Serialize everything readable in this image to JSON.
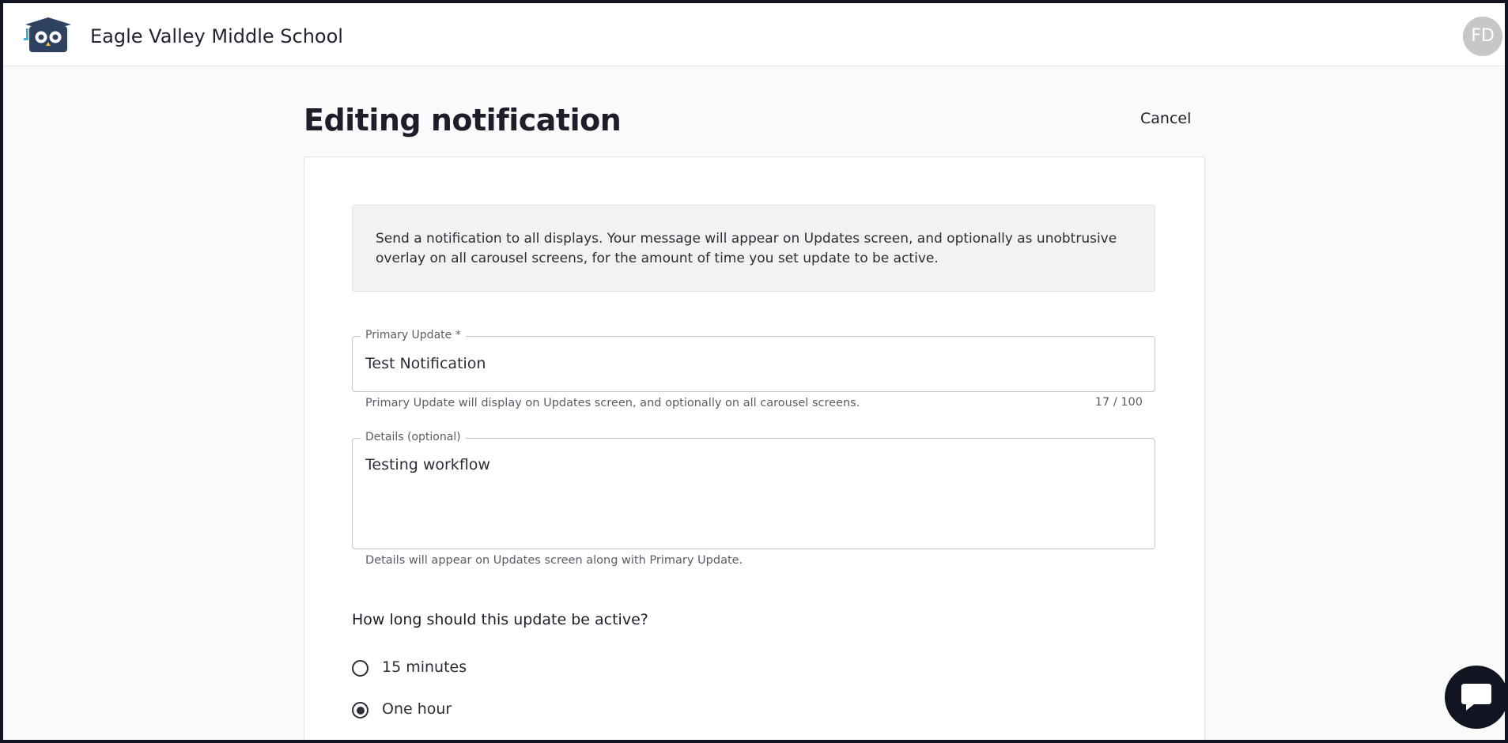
{
  "header": {
    "school_name": "Eagle Valley Middle School",
    "avatar_initials": "FD",
    "logo_icon": "owl-graduation-cap-icon"
  },
  "page": {
    "title": "Editing notification",
    "cancel_label": "Cancel"
  },
  "form": {
    "info_text": "Send a notification to all displays. Your message will appear on Updates screen, and optionally as unobtrusive overlay on all carousel screens, for the amount of time you set update to be active.",
    "primary_update": {
      "label": "Primary Update *",
      "value": "Test Notification",
      "helper": "Primary Update will display on Updates screen, and optionally on all carousel screens.",
      "counter": "17 / 100"
    },
    "details": {
      "label": "Details (optional)",
      "value": "Testing workflow",
      "helper": "Details will appear on Updates screen along with Primary Update."
    },
    "duration": {
      "question": "How long should this update be active?",
      "options": [
        {
          "label": "15 minutes",
          "selected": false
        },
        {
          "label": "One hour",
          "selected": true
        }
      ]
    }
  },
  "chat": {
    "icon": "chat-bubble-icon"
  },
  "colors": {
    "dark": "#101521",
    "background": "#fafafa",
    "avatar": "#c7c7c7"
  }
}
